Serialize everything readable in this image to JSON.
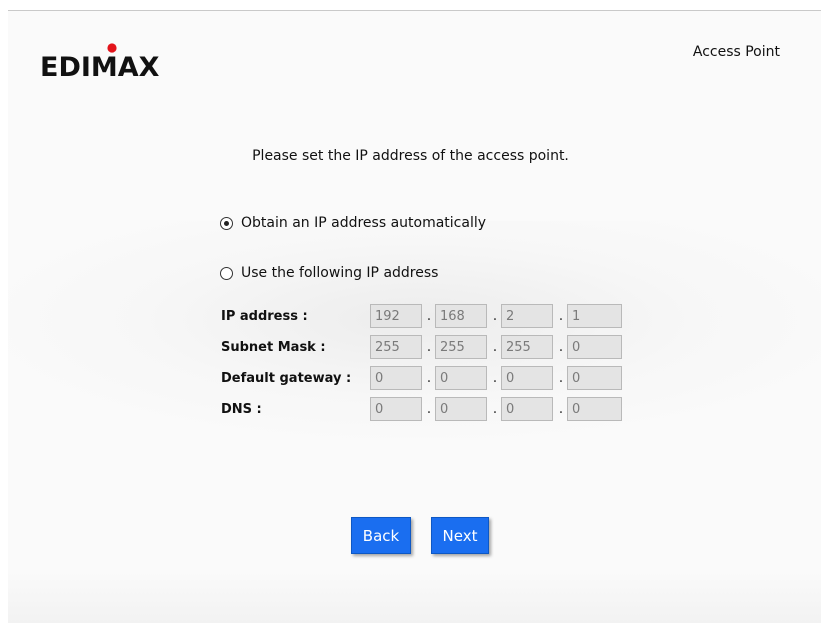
{
  "header": {
    "logo_text": "EDIMAX",
    "mode_label": "Access Point"
  },
  "instruction": "Please set the IP address of the access point.",
  "options": {
    "auto_label": "Obtain an IP address automatically",
    "auto_selected": true,
    "manual_label": "Use the following IP address",
    "manual_selected": false
  },
  "fields": [
    {
      "label": "IP address :",
      "octets": [
        "192",
        "168",
        "2",
        "1"
      ]
    },
    {
      "label": "Subnet Mask :",
      "octets": [
        "255",
        "255",
        "255",
        "0"
      ]
    },
    {
      "label": "Default gateway :",
      "octets": [
        "0",
        "0",
        "0",
        "0"
      ]
    },
    {
      "label": "DNS :",
      "octets": [
        "0",
        "0",
        "0",
        "0"
      ]
    }
  ],
  "separator": ".",
  "buttons": {
    "back_label": "Back",
    "next_label": "Next"
  },
  "colors": {
    "button_blue": "#1a6ef0",
    "logo_red": "#e3141b",
    "input_bg": "#e4e4e4"
  }
}
